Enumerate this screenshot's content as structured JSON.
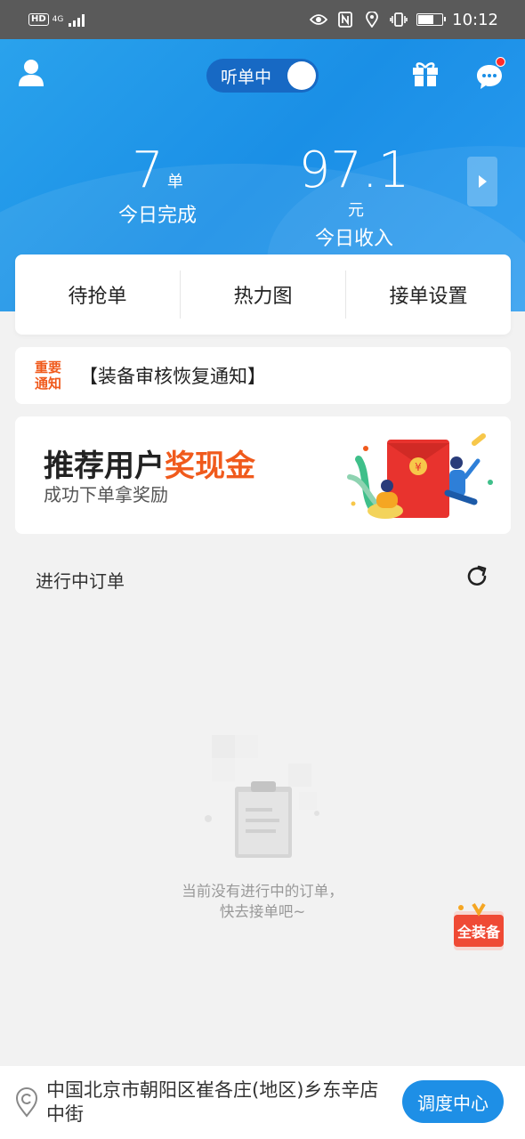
{
  "status_bar": {
    "hd": "HD",
    "network": "4G",
    "time": "10:12"
  },
  "header": {
    "listen_label": "听单中",
    "orders_value": "7",
    "orders_unit": "单",
    "orders_label": "今日完成",
    "income_value": "97.1",
    "income_unit": "元",
    "income_label": "今日收入",
    "icons": [
      "user-icon",
      "gift-icon",
      "message-icon",
      "chevron-right-icon"
    ],
    "accent": "#1e8fe6"
  },
  "tabs": [
    {
      "label": "待抢单"
    },
    {
      "label": "热力图"
    },
    {
      "label": "接单设置"
    }
  ],
  "notice": {
    "tag_line1": "重要",
    "tag_line2": "通知",
    "text": "【装备审核恢复通知】",
    "tag_color": "#f05a1c"
  },
  "promo": {
    "title_prefix": "推荐用户",
    "title_highlight": "奖现金",
    "subtitle": "成功下单拿奖励"
  },
  "ongoing": {
    "title": "进行中订单",
    "empty_line1": "当前没有进行中的订单，",
    "empty_line2": "快去接单吧~"
  },
  "float_badge": {
    "text": "全装备"
  },
  "bottom": {
    "address": "中国北京市朝阳区崔各庄(地区)乡东辛店中街",
    "dispatch_label": "调度中心"
  }
}
